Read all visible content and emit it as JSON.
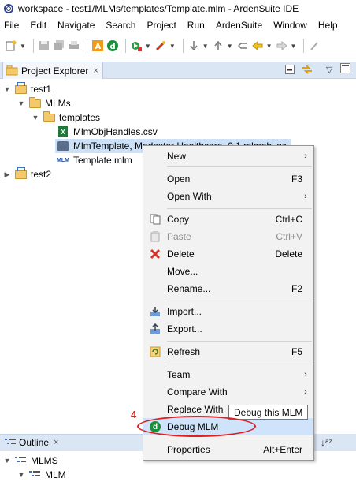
{
  "window": {
    "title": "workspace - test1/MLMs/templates/Template.mlm - ArdenSuite IDE"
  },
  "menubar": [
    "File",
    "Edit",
    "Navigate",
    "Search",
    "Project",
    "Run",
    "ArdenSuite",
    "Window",
    "Help"
  ],
  "project_explorer": {
    "tab_label": "Project Explorer",
    "close_glyph": "×",
    "tree": [
      {
        "label": "test1",
        "twisty": "▼",
        "icon": "project-icon"
      },
      {
        "label": "MLMs",
        "twisty": "▼",
        "icon": "folder-icon"
      },
      {
        "label": "templates",
        "twisty": "▼",
        "icon": "folder-icon"
      },
      {
        "label": "MlmObjHandles.csv",
        "icon": "csv-file-icon"
      },
      {
        "label": "MlmTemplate, Medexter Healthcare, 0.1.mlmobj.gz",
        "icon": "archive-file-icon"
      },
      {
        "label": "Template.mlm",
        "icon": "mlm-file-icon"
      },
      {
        "label": "test2",
        "twisty": "▶",
        "icon": "project-icon"
      }
    ]
  },
  "context_menu": {
    "items": [
      {
        "label": "New",
        "shortcut": "",
        "submenu": true
      },
      {
        "label": "Open",
        "shortcut": "F3"
      },
      {
        "label": "Open With",
        "shortcut": "",
        "submenu": true
      },
      {
        "label": "Copy",
        "shortcut": "Ctrl+C"
      },
      {
        "label": "Paste",
        "shortcut": "Ctrl+V",
        "disabled": true
      },
      {
        "label": "Delete",
        "shortcut": "Delete"
      },
      {
        "label": "Move...",
        "shortcut": ""
      },
      {
        "label": "Rename...",
        "shortcut": "F2"
      },
      {
        "label": "Import...",
        "shortcut": ""
      },
      {
        "label": "Export...",
        "shortcut": ""
      },
      {
        "label": "Refresh",
        "shortcut": "F5"
      },
      {
        "label": "Team",
        "shortcut": "",
        "submenu": true
      },
      {
        "label": "Compare With",
        "shortcut": "",
        "submenu": true
      },
      {
        "label": "Replace With",
        "shortcut": "",
        "submenu": true
      },
      {
        "label": "Debug MLM",
        "shortcut": "",
        "highlighted": true
      },
      {
        "label": "Properties",
        "shortcut": "Alt+Enter"
      }
    ],
    "submenu_glyph": "›"
  },
  "tooltip": {
    "text": "Debug this MLM"
  },
  "annotation": {
    "step_number": "4",
    "color": "#e02020"
  },
  "outline": {
    "tab_label": "Outline",
    "tree": [
      {
        "label": "MLMS",
        "twisty": "▼"
      },
      {
        "label": "MLM",
        "twisty": "▼"
      }
    ]
  },
  "colors": {
    "selection": "#cce0f7",
    "menu_highlight": "#cfe3fb",
    "panel_header": "#dbe6f4",
    "debug_green": "#1b8f3a"
  }
}
